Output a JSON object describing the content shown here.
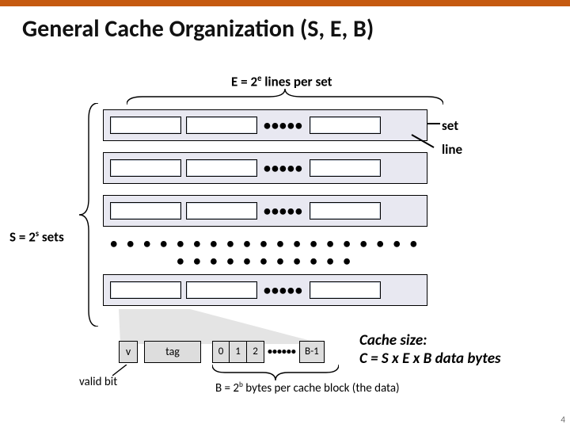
{
  "title": "General Cache Organization (S, E, B)",
  "top_label_html": "E = 2<sup>e</sup> lines per set",
  "left_label_html": "S = 2<sup>s</sup> sets",
  "callout_set": "set",
  "callout_line": "line",
  "detail": {
    "v": "v",
    "tag": "tag",
    "bytes": [
      "0",
      "1",
      "2"
    ],
    "last": "B-1"
  },
  "validbit_label": "valid bit",
  "B_label_html": "B = 2<sup>b</sup> bytes per cache block (the data)",
  "cachesize_line1": "Cache size:",
  "cachesize_line2": "C = S x E x B data bytes",
  "page_number": "4"
}
